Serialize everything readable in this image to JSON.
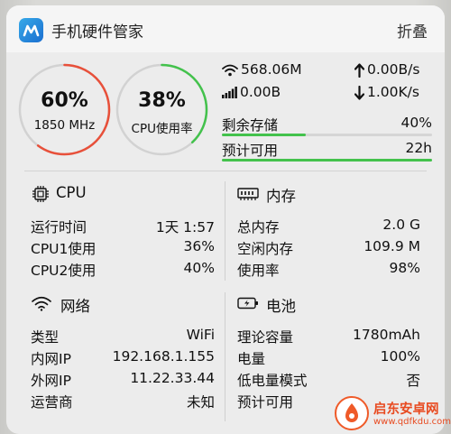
{
  "app": {
    "title": "手机硬件管家",
    "fold_label": "折叠",
    "icon": "app-logo-icon"
  },
  "rings": [
    {
      "value": "60%",
      "sub": "1850 MHz",
      "percent": 60,
      "color": "#e8503a"
    },
    {
      "value": "38%",
      "sub": "CPU使用率",
      "percent": 38,
      "color": "#43c24c"
    }
  ],
  "network_speed": {
    "wifi_total": "568.06M",
    "cell_total": "0.00B",
    "upload": "0.00B/s",
    "download": "1.00K/s"
  },
  "storage": {
    "remaining_label": "剩余存储",
    "remaining_value": "40%",
    "remaining_percent": 40,
    "estimate_label": "预计可用",
    "estimate_value": "22h",
    "estimate_percent": 100
  },
  "cpu": {
    "title": "CPU",
    "rows": [
      {
        "label": "运行时间",
        "value": "1天 1:57"
      },
      {
        "label": "CPU1使用",
        "value": "36%"
      },
      {
        "label": "CPU2使用",
        "value": "40%"
      }
    ]
  },
  "memory": {
    "title": "内存",
    "rows": [
      {
        "label": "总内存",
        "value": "2.0 G"
      },
      {
        "label": "空闲内存",
        "value": "109.9 M"
      },
      {
        "label": "使用率",
        "value": "98%"
      }
    ]
  },
  "network": {
    "title": "网络",
    "rows": [
      {
        "label": "类型",
        "value": "WiFi"
      },
      {
        "label": "内网IP",
        "value": "192.168.1.155"
      },
      {
        "label": "外网IP",
        "value": "11.22.33.44"
      },
      {
        "label": "运营商",
        "value": "未知"
      }
    ]
  },
  "battery": {
    "title": "电池",
    "rows": [
      {
        "label": "理论容量",
        "value": "1780mAh"
      },
      {
        "label": "电量",
        "value": "100%"
      },
      {
        "label": "低电量模式",
        "value": "否"
      },
      {
        "label": "预计可用",
        "value": ""
      }
    ]
  },
  "watermark": {
    "line1": "启东安卓网",
    "line2": "www.qdfkdu.com"
  },
  "colors": {
    "accent_green": "#43c24c",
    "accent_red": "#e8503a"
  }
}
